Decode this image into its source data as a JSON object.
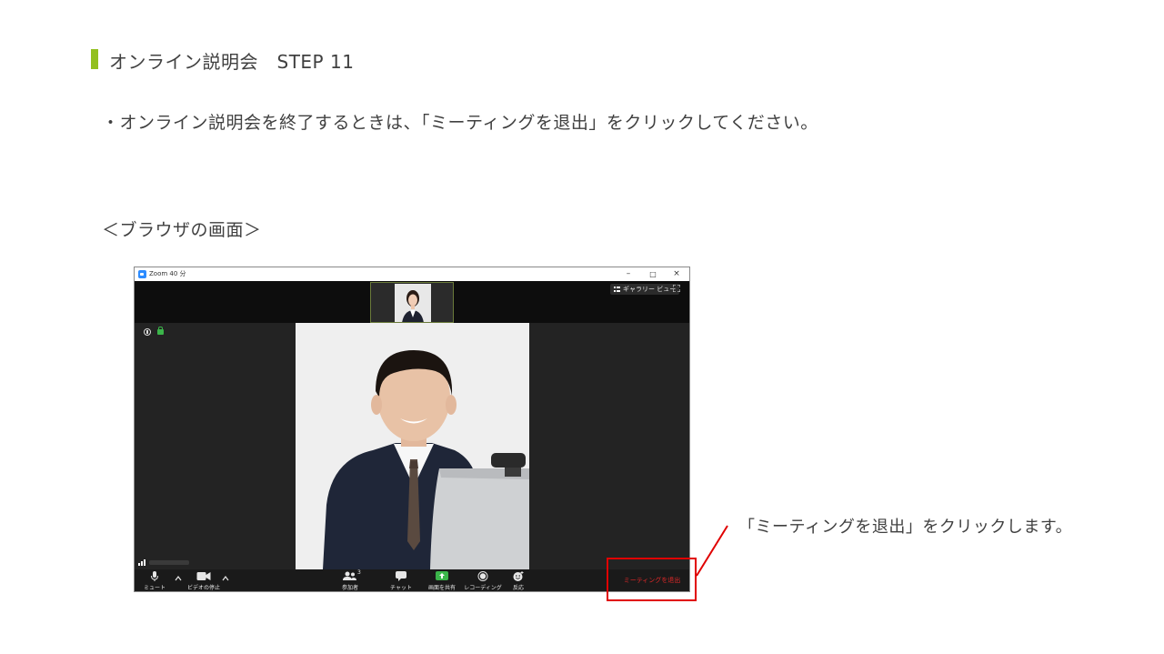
{
  "heading": {
    "title": "オンライン説明会　STEP 11"
  },
  "instruction": "・オンライン説明会を終了するときは、「ミーティングを退出」をクリックしてください。",
  "screen_label": "＜ブラウザの画面＞",
  "callout": "「ミーティングを退出」をクリックします。",
  "window": {
    "title": "Zoom 40 分",
    "minimize": "–",
    "maximize": "□",
    "close": "×",
    "gallery_view_label": "ギャラリー ビュー",
    "toolbar": {
      "mute_label": "ミュート",
      "video_label": "ビデオの停止",
      "participants_label": "参加者",
      "participants_count": "3",
      "chat_label": "チャット",
      "share_label": "画面を共有",
      "record_label": "レコーディング",
      "reactions_label": "反応",
      "leave_label": "ミーティングを退出"
    }
  },
  "colors": {
    "accent_bar": "#92c01f",
    "leave_text": "#e02828",
    "highlight": "#e00000",
    "share_button": "#3bb54a",
    "zoom_blue": "#2d8cff"
  }
}
